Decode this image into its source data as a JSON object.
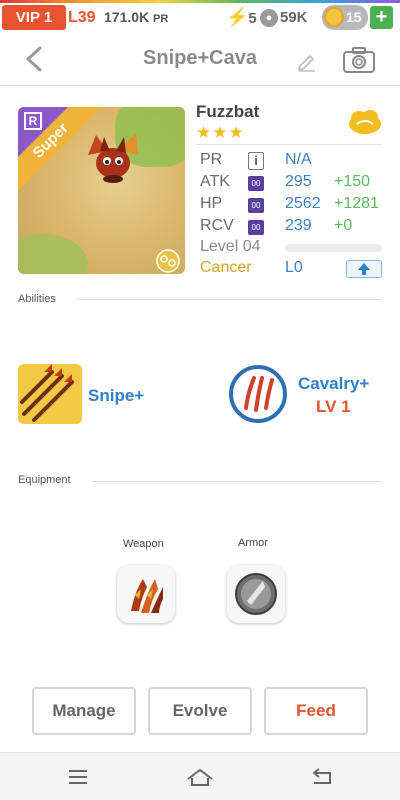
{
  "status": {
    "vip": "VIP 1",
    "level": "L39",
    "power": "171.0K",
    "power_unit": "PR",
    "energy": "5",
    "paws": "59K",
    "coins": "15",
    "add_label": "+"
  },
  "header": {
    "title": "Snipe+Cava"
  },
  "pet": {
    "name": "Fuzzbat",
    "stars": "★★★",
    "rarity_badge": "R",
    "grade": "Super",
    "stats": [
      {
        "label": "PR",
        "value": "N/A",
        "bonus": ""
      },
      {
        "label": "ATK",
        "tag": "00",
        "value": "295",
        "bonus": "+150"
      },
      {
        "label": "HP",
        "tag": "00",
        "value": "2562",
        "bonus": "+1281"
      },
      {
        "label": "RCV",
        "tag": "00",
        "value": "239",
        "bonus": "+0"
      }
    ],
    "level": "Level 04",
    "zodiac": "Cancer",
    "zodiac_level": "L0"
  },
  "abilities": {
    "heading": "Abilities",
    "items": [
      {
        "name": "Snipe+"
      },
      {
        "name": "Cavalry+",
        "level": "LV 1"
      }
    ]
  },
  "equipment": {
    "heading": "Equipment",
    "weapon_label": "Weapon",
    "armor_label": "Armor"
  },
  "actions": {
    "manage": "Manage",
    "evolve": "Evolve",
    "feed": "Feed"
  },
  "colors": {
    "accent_orange": "#e8532f",
    "link_blue": "#2e81c8",
    "bonus_green": "#5cb85c",
    "star_gold": "#f2be1e"
  }
}
